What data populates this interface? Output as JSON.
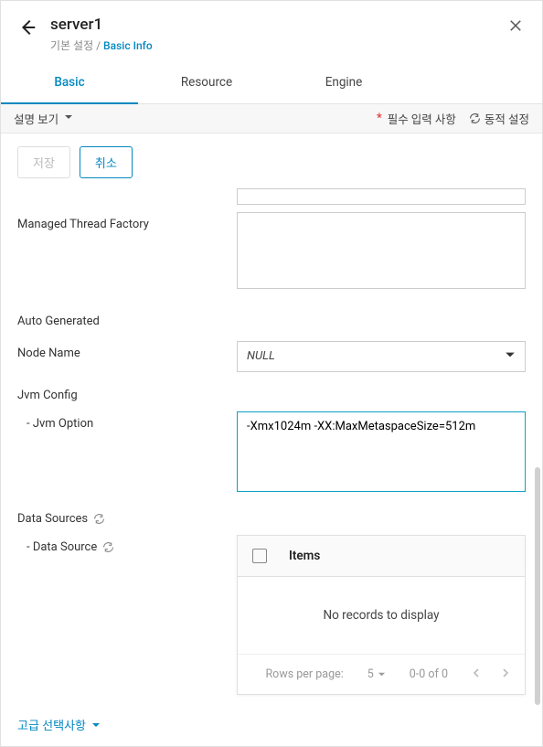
{
  "header": {
    "title": "server1",
    "breadcrumb_parent": "기본 설정",
    "breadcrumb_sep": " / ",
    "breadcrumb_current": "Basic Info"
  },
  "tabs": [
    "Basic",
    "Resource",
    "Engine"
  ],
  "strip": {
    "view_label": "설명 보기",
    "required_label": "필수 입력 사항",
    "dynamic_label": "동적 설정"
  },
  "buttons": {
    "save": "저장",
    "cancel": "취소"
  },
  "form": {
    "managed_thread_factory_label": "Managed Thread Factory",
    "auto_generated_label": "Auto Generated",
    "node_name_label": "Node Name",
    "node_name_value": "NULL",
    "jvm_config_label": "Jvm Config",
    "jvm_option_label": "- Jvm Option",
    "jvm_option_value": "-Xmx1024m -XX:MaxMetaspaceSize=512m",
    "data_sources_label": "Data Sources",
    "data_source_label": "- Data Source"
  },
  "table": {
    "col_items": "Items",
    "empty": "No records to display",
    "rows_per_page_label": "Rows per page:",
    "rows_per_page_value": "5",
    "range": "0-0 of 0"
  },
  "advanced_label": "고급 선택사항"
}
